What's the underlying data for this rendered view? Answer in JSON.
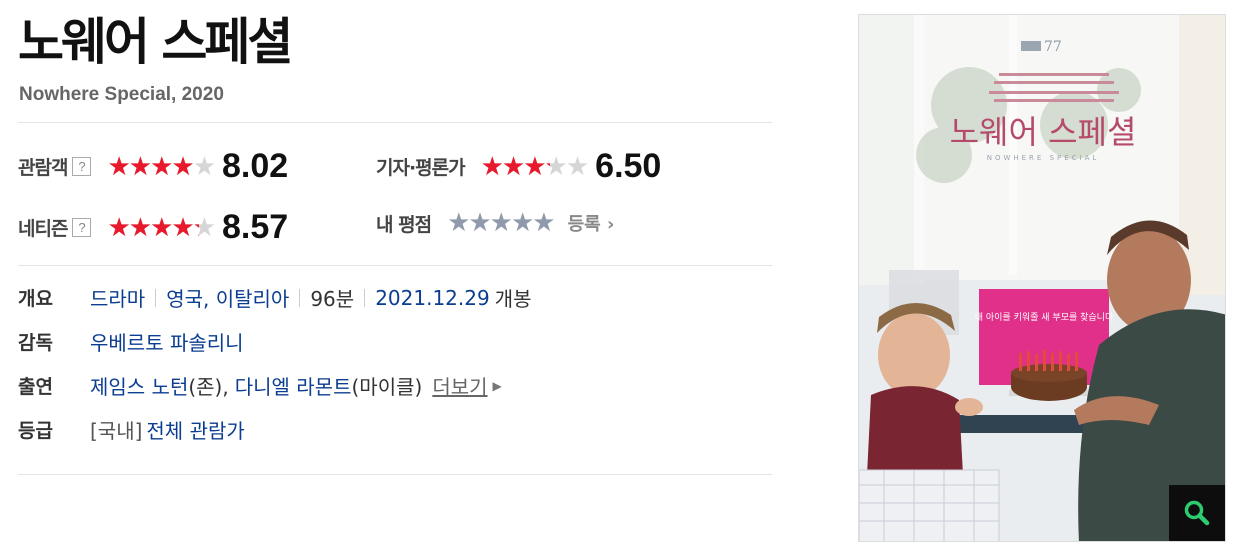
{
  "movie": {
    "title": "노웨어 스페셜",
    "subtitle": "Nowhere Special, 2020"
  },
  "ratings": {
    "audience": {
      "label": "관람객",
      "help": "?",
      "stars": "★★★★★",
      "fill_fraction": 0.802,
      "score": "8.02"
    },
    "critics": {
      "label": "기자·평론가",
      "stars": "★★★★★",
      "fill_fraction": 0.65,
      "score": "6.50"
    },
    "netizen": {
      "label": "네티즌",
      "help": "?",
      "stars": "★★★★★",
      "fill_fraction": 0.857,
      "score": "8.57"
    },
    "mine": {
      "label": "내 평점",
      "stars": "★★★★★",
      "register": "등록 ›"
    }
  },
  "info": {
    "overview_label": "개요",
    "genre": "드라마",
    "countries": "영국, 이탈리아",
    "runtime": "96분",
    "release_date": "2021.12.29",
    "release_suffix": "개봉",
    "director_label": "감독",
    "director": "우베르토 파솔리니",
    "cast_label": "출연",
    "cast1": "제임스 노턴",
    "cast1_role": "(존),",
    "cast2": "다니엘 라몬트",
    "cast2_role": "(마이클)",
    "more": "더보기",
    "grade_label": "등급",
    "grade_region": "[국내]",
    "grade": "전체 관람가"
  },
  "poster": {
    "title": "노웨어 스페셜",
    "subtitle": "NOWHERE SPECIAL",
    "festival_mark": "77",
    "tagline": "내 아이를 키워줄 새 부모를 찾습니다",
    "zoom_icon": "magnifier-icon",
    "colors": {
      "wall": "#e9edf0",
      "window": "#f7f8f6",
      "sign": "#e0308a",
      "table": "#2f4350",
      "zoom_icon": "#2ecc71"
    }
  }
}
